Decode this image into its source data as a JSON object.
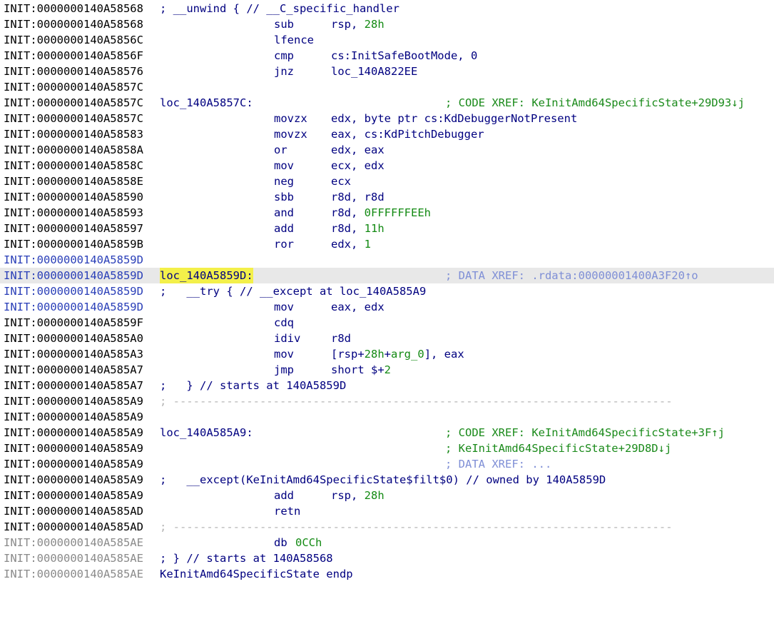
{
  "listing": {
    "rows": [
      {
        "addr": "INIT:0000000140A58568",
        "comment": "; __unwind { // __C_specific_handler"
      },
      {
        "addr": "INIT:0000000140A58568",
        "mnem": "sub",
        "op": "rsp, 28h"
      },
      {
        "addr": "INIT:0000000140A5856C",
        "mnem": "lfence"
      },
      {
        "addr": "INIT:0000000140A5856F",
        "mnem": "cmp",
        "op": "cs:InitSafeBootMode, 0"
      },
      {
        "addr": "INIT:0000000140A58576",
        "mnem": "jnz",
        "op": "loc_140A822EE"
      },
      {
        "addr": "INIT:0000000140A5857C"
      },
      {
        "addr": "INIT:0000000140A5857C",
        "label": "loc_140A5857C:",
        "xref": "; CODE XREF: KeInitAmd64SpecificState+29D93↓j"
      },
      {
        "addr": "INIT:0000000140A5857C",
        "mnem": "movzx",
        "op": "edx, byte ptr cs:KdDebuggerNotPresent"
      },
      {
        "addr": "INIT:0000000140A58583",
        "mnem": "movzx",
        "op": "eax, cs:KdPitchDebugger"
      },
      {
        "addr": "INIT:0000000140A5858A",
        "mnem": "or",
        "op": "edx, eax"
      },
      {
        "addr": "INIT:0000000140A5858C",
        "mnem": "mov",
        "op": "ecx, edx"
      },
      {
        "addr": "INIT:0000000140A5858E",
        "mnem": "neg",
        "op": "ecx"
      },
      {
        "addr": "INIT:0000000140A58590",
        "mnem": "sbb",
        "op": "r8d, r8d"
      },
      {
        "addr": "INIT:0000000140A58593",
        "mnem": "and",
        "op": "r8d, 0FFFFFFEEh"
      },
      {
        "addr": "INIT:0000000140A58597",
        "mnem": "add",
        "op": "r8d, 11h"
      },
      {
        "addr": "INIT:0000000140A5859B",
        "mnem": "ror",
        "op": "edx, 1"
      },
      {
        "addr": "INIT:0000000140A5859D"
      },
      {
        "addr": "INIT:0000000140A5859D",
        "label": "loc_140A5859D:",
        "xref": "; DATA XREF: .rdata:00000001400A3F20↑o"
      },
      {
        "addr": "INIT:0000000140A5859D",
        "comment": ";   __try { // __except at loc_140A585A9"
      },
      {
        "addr": "INIT:0000000140A5859D",
        "mnem": "mov",
        "op": "eax, edx"
      },
      {
        "addr": "INIT:0000000140A5859F",
        "mnem": "cdq"
      },
      {
        "addr": "INIT:0000000140A585A0",
        "mnem": "idiv",
        "op": "r8d"
      },
      {
        "addr": "INIT:0000000140A585A3",
        "mnem": "mov",
        "op": "[rsp+28h+arg_0], eax"
      },
      {
        "addr": "INIT:0000000140A585A7",
        "mnem": "jmp",
        "op": "short $+2"
      },
      {
        "addr": "INIT:0000000140A585A7",
        "comment": ";   } // starts at 140A5859D"
      },
      {
        "addr": "INIT:0000000140A585A9",
        "sep": "; ---------------------------------------------------------------------------"
      },
      {
        "addr": "INIT:0000000140A585A9"
      },
      {
        "addr": "INIT:0000000140A585A9",
        "label": "loc_140A585A9:",
        "xref": "; CODE XREF: KeInitAmd64SpecificState+3F↑j"
      },
      {
        "addr": "INIT:0000000140A585A9",
        "xref": "; KeInitAmd64SpecificState+29D8D↓j"
      },
      {
        "addr": "INIT:0000000140A585A9",
        "xref": "; DATA XREF: ..."
      },
      {
        "addr": "INIT:0000000140A585A9",
        "comment": ";   __except(KeInitAmd64SpecificState$filt$0) // owned by 140A5859D"
      },
      {
        "addr": "INIT:0000000140A585A9",
        "mnem": "add",
        "op": "rsp, 28h"
      },
      {
        "addr": "INIT:0000000140A585AD",
        "mnem": "retn"
      },
      {
        "addr": "INIT:0000000140A585AD",
        "sep": "; ---------------------------------------------------------------------------"
      },
      {
        "addr": "INIT:0000000140A585AE",
        "mnem": "db",
        "op": "0CCh"
      },
      {
        "addr": "INIT:0000000140A585AE",
        "comment": "; } // starts at 140A58568"
      },
      {
        "addr": "INIT:0000000140A585AE",
        "comment": "KeInitAmd64SpecificState endp"
      }
    ]
  },
  "colors": {
    "default_text": "#000080",
    "address": "#000000",
    "address_selected_range": "#2a3fb8",
    "address_unexplored": "#8a8a8a",
    "xref_comment": "#1a8a1a",
    "data_xref_comment": "#7f8fd6",
    "separator": "#b4b4b4",
    "numeric_literal": "#138a13",
    "label_highlight": "#f3f04a",
    "current_line": "#e8e8e8"
  }
}
